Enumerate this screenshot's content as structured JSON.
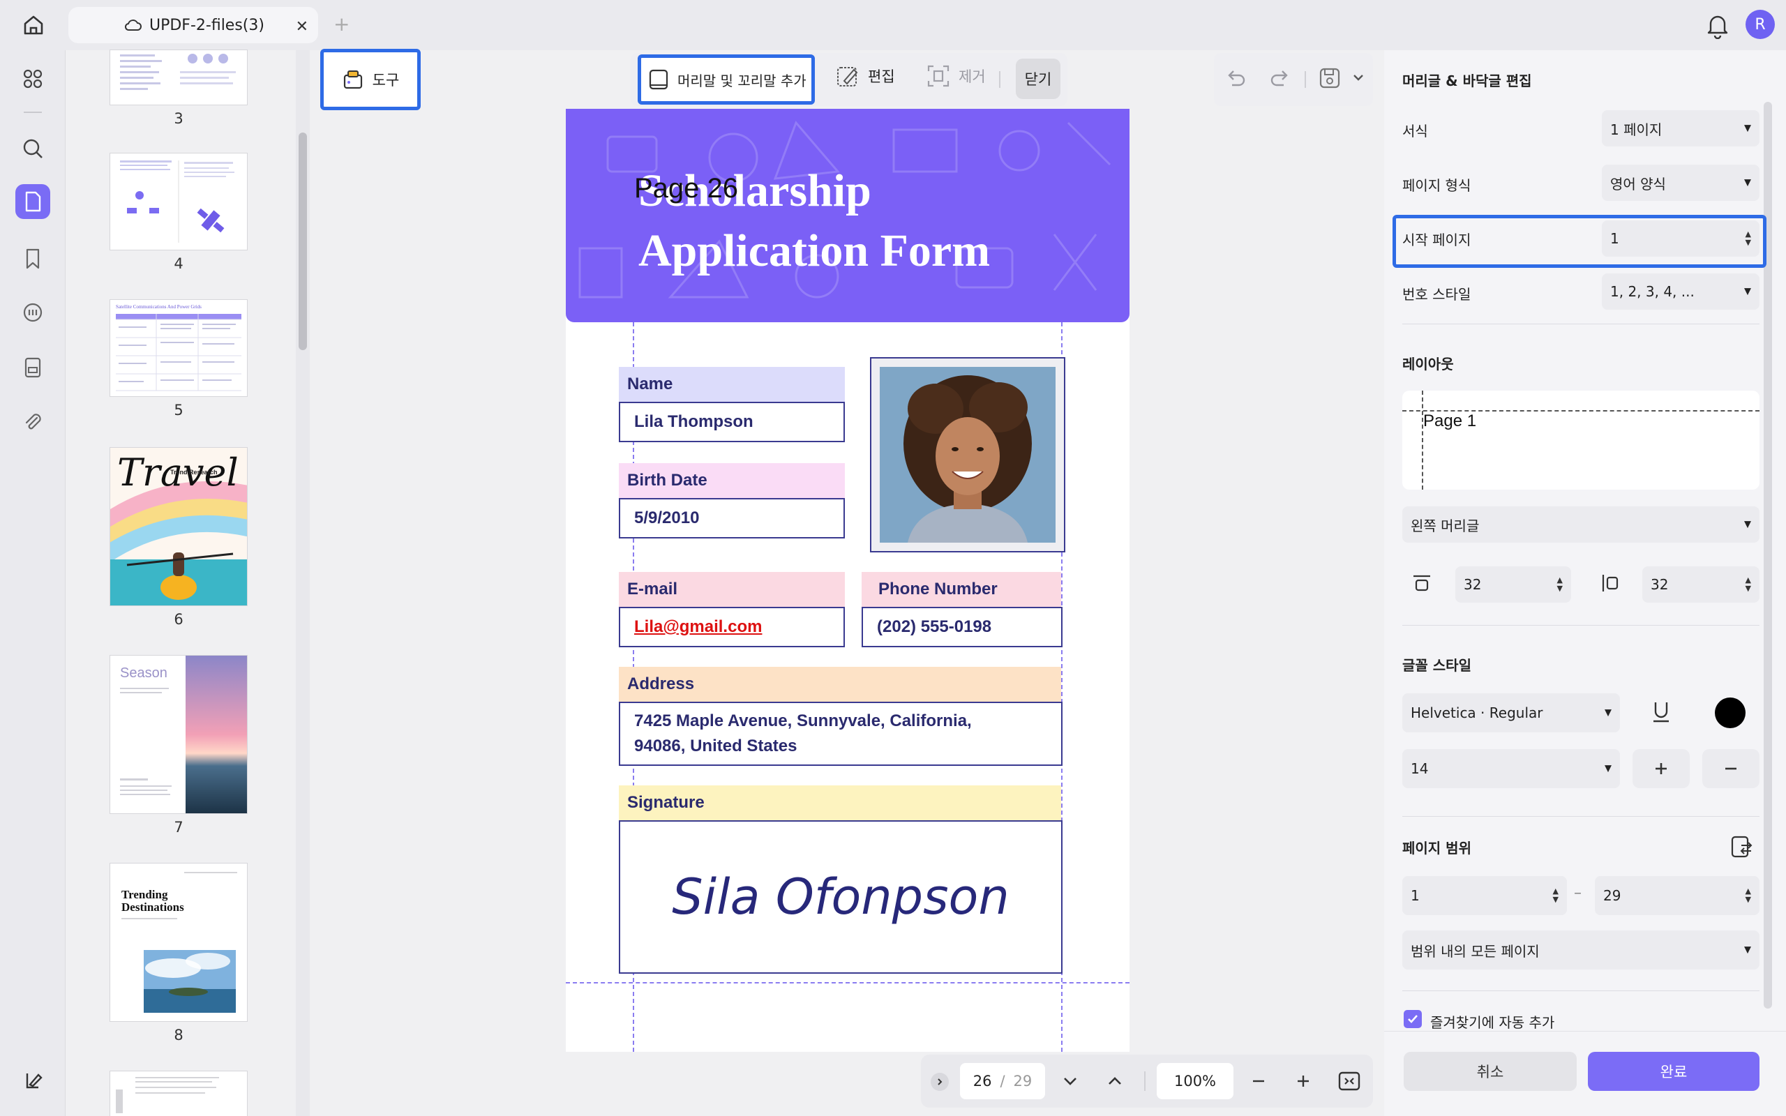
{
  "app": {
    "tab_title": "UPDF-2-files(3)",
    "user_initial": "R",
    "accent_color": "#7a6cf5",
    "highlight_color": "#2e6be6"
  },
  "sidebar_icons": [
    "home-icon",
    "grid-icon",
    "search-icon",
    "document-icon",
    "bookmark-icon",
    "comment-icon",
    "form-icon",
    "attachment-icon",
    "layers-icon"
  ],
  "thumbnails": [
    {
      "page": "3"
    },
    {
      "page": "4"
    },
    {
      "page": "5",
      "title": "Satellite Communications And Power Grids"
    },
    {
      "page": "6",
      "title": "Travel",
      "subtitle": "Trend Research"
    },
    {
      "page": "7",
      "title": "Season"
    },
    {
      "page": "8",
      "title": "Trending Destinations"
    }
  ],
  "tools_button": "도구",
  "edit_toolbar": {
    "add_header_footer": "머리말 및 꼬리말 추가",
    "edit": "편집",
    "remove": "제거",
    "close": "닫기"
  },
  "document": {
    "header_overlay": "Page 26",
    "title_line1": "Scholarship",
    "title_line2": "Application Form",
    "fields": {
      "name_label": "Name",
      "name_value": "Lila Thompson",
      "birth_label": "Birth Date",
      "birth_value": "5/9/2010",
      "email_label": "E-mail",
      "email_value": "Lila@gmail.com",
      "phone_label": "Phone Number",
      "phone_value": "(202) 555-0198",
      "address_label": "Address",
      "address_line1": "7425 Maple Avenue, Sunnyvale, California,",
      "address_line2": "94086, United States",
      "signature_label": "Signature",
      "signature_value": "Sila Ofonpson"
    }
  },
  "page_nav": {
    "current": "26",
    "separator": "/",
    "total": "29",
    "zoom": "100%"
  },
  "panel": {
    "title": "머리글 & 바닥글 편집",
    "format_label": "서식",
    "format_value": "1 페이지",
    "page_format_label": "페이지 형식",
    "page_format_value": "영어 양식",
    "start_page_label": "시작 페이지",
    "start_page_value": "1",
    "number_style_label": "번호 스타일",
    "number_style_value": "1, 2, 3, 4, ...",
    "layout_heading": "레이아웃",
    "layout_preview_text": "Page 1",
    "position_value": "왼쪽 머리글",
    "margin_top": "32",
    "margin_side": "32",
    "font_heading": "글꼴 스타일",
    "font_value": "Helvetica · Regular",
    "font_size": "14",
    "font_color": "#000000",
    "range_heading": "페이지 범위",
    "range_from": "1",
    "range_dash": "–",
    "range_to": "29",
    "range_option": "범위 내의 모든 페이지",
    "bookmark_checkbox": "즐겨찾기에 자동 추가",
    "bookmark_checked": true,
    "cancel": "취소",
    "done": "완료"
  }
}
